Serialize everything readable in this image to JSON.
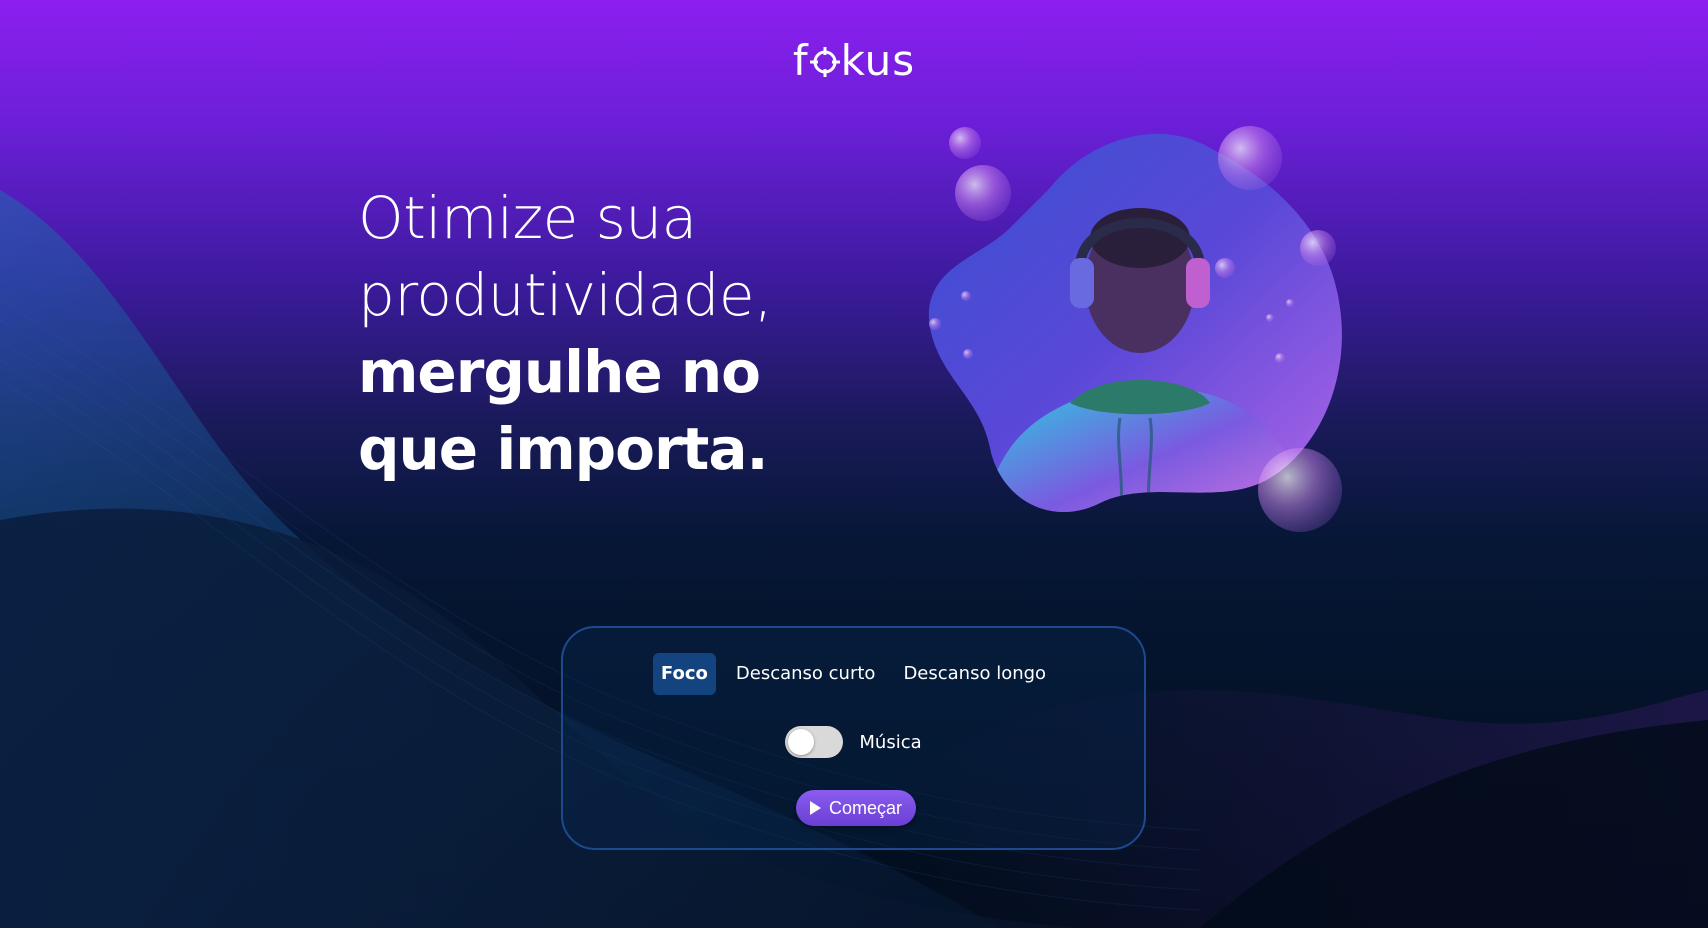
{
  "brand": {
    "logo_prefix": "f",
    "logo_suffix": "kus"
  },
  "hero": {
    "line1": "Otimize sua",
    "line2": "produtividade,",
    "line3": "mergulhe no",
    "line4": "que importa."
  },
  "timer_card": {
    "tabs": [
      {
        "label": "Foco",
        "active": true
      },
      {
        "label": "Descanso curto",
        "active": false
      },
      {
        "label": "Descanso longo",
        "active": false
      }
    ],
    "music_label": "Música",
    "music_enabled": false,
    "start_label": "Começar"
  },
  "colors": {
    "background_top": "#8c1ff0",
    "background_bottom": "#020d1c",
    "active_tab": "#144480",
    "card_border": "#1d4a8e",
    "start_button": "#6b3fd4"
  },
  "icons": {
    "logo_target": "crosshair-icon",
    "start": "play-icon"
  }
}
